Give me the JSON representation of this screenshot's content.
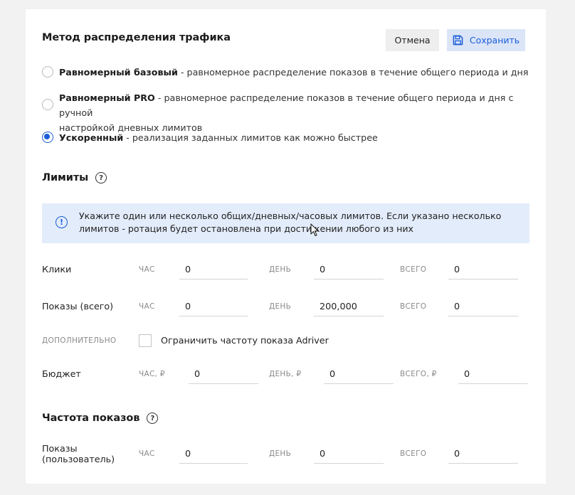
{
  "traffic": {
    "title": "Метод распределения трафика",
    "cancel_label": "Отмена",
    "save_label": "Сохранить",
    "options": [
      {
        "title": "Равномерный базовый",
        "desc": " - равномерное распределение показов в течение общего периода и дня",
        "selected": false
      },
      {
        "title": "Равномерный PRO",
        "desc": " - равномерное распределение показов в течение общего периода и дня с ручной",
        "desc2": "настройкой дневных лимитов",
        "selected": false
      },
      {
        "title": "Ускоренный",
        "desc": " - реализация заданных лимитов как можно быстрее",
        "selected": true
      }
    ]
  },
  "limits": {
    "title": "Лимиты",
    "help": "?",
    "info_line1": "Укажите один или несколько общих/дневных/часовых лимитов. Если указано несколько",
    "info_line2": "лимитов - ротация будет остановлена при достижении любого из них",
    "info_icon": "!",
    "clicks": {
      "label": "Клики",
      "hour_label": "ЧАС",
      "day_label": "ДЕНЬ",
      "total_label": "ВСЕГО",
      "hour": "0",
      "day": "0",
      "total": "0"
    },
    "impressions": {
      "label": "Показы (всего)",
      "hour_label": "ЧАС",
      "day_label": "ДЕНЬ",
      "total_label": "ВСЕГО",
      "hour": "0",
      "day": "200,000",
      "total": "0"
    },
    "extra": {
      "label": "ДОПОЛНИТЕЛЬНО",
      "checkbox_label": "Ограничить частоту показа Adriver",
      "checked": false
    },
    "budget": {
      "label": "Бюджет",
      "hour_label": "ЧАС, ₽",
      "day_label": "ДЕНЬ, ₽",
      "total_label": "ВСЕГО, ₽",
      "hour": "0",
      "day": "0",
      "total": "0"
    }
  },
  "frequency": {
    "title": "Частота показов",
    "help": "?",
    "user": {
      "label_line1": "Показы",
      "label_line2": "(пользователь)",
      "hour_label": "ЧАС",
      "day_label": "ДЕНЬ",
      "total_label": "ВСЕГО",
      "hour": "0",
      "day": "0",
      "total": "0"
    }
  },
  "colors": {
    "accent": "#1a5dd8",
    "info_bg": "#e3ecfa",
    "save_bg": "#dbe5f7"
  }
}
